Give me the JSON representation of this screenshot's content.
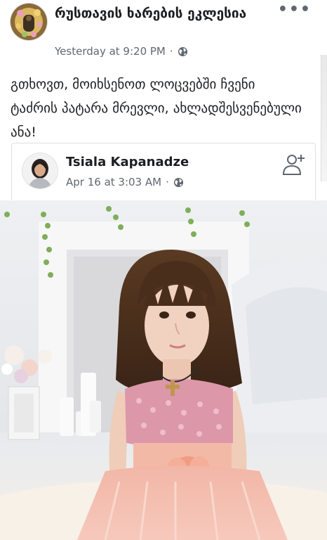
{
  "post": {
    "page_name": "რუსთავის ხარების ეკლესია",
    "timestamp": "Yesterday at 9:20 PM",
    "separator": "·",
    "audience_icon": "globe-icon",
    "more_label": "•••",
    "text": "გთხოვთ, მოიხსენოთ ლოცვებში ჩვენი ტაძრის პატარა მრევლი, ახლადშესვენებული ანა!"
  },
  "shared": {
    "name": "Tsiala Kapanadze",
    "timestamp": "Apr 16 at 3:03 AM",
    "separator": "·",
    "audience_icon": "globe-icon",
    "action_icon": "add-friend-icon"
  },
  "colors": {
    "text": "#1c1e21",
    "meta": "#606770",
    "border": "#dddfe2"
  }
}
